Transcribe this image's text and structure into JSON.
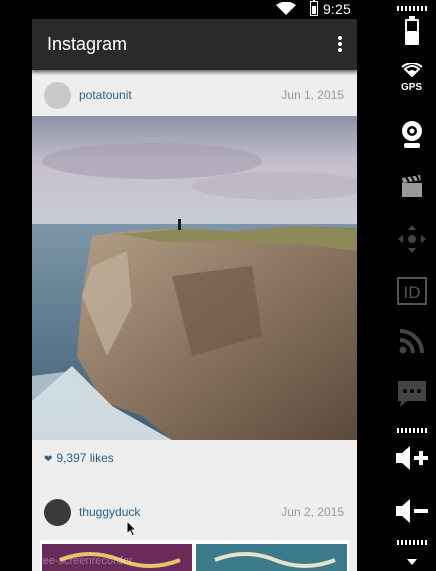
{
  "status_bar": {
    "time": "9:25"
  },
  "app_bar": {
    "title": "Instagram",
    "menu_icon": "more-vert-icon"
  },
  "posts": [
    {
      "username": "potatounit",
      "date": "Jun 1, 2015",
      "likes": "9,397 likes",
      "heart_icon": "heart-icon"
    },
    {
      "username": "thuggyduck",
      "date": "Jun 2, 2015"
    }
  ],
  "side_panel": {
    "gps_label": "GPS",
    "id_label": "ID",
    "icons": [
      "battery-icon",
      "gps-icon",
      "camera-icon",
      "clapperboard-icon",
      "dpad-icon",
      "id-icon",
      "rss-icon",
      "sms-icon",
      "volume-up-icon",
      "volume-down-icon"
    ]
  },
  "watermark": "free-screenrecorder"
}
